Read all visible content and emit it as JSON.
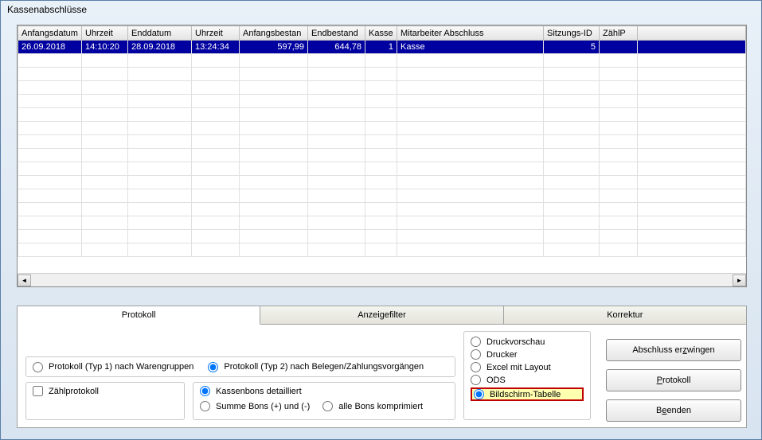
{
  "title": "Kassenabschlüsse",
  "columns": [
    "Anfangsdatum",
    "Uhrzeit",
    "Enddatum",
    "Uhrzeit",
    "Anfangsbestan",
    "Endbestand",
    "Kasse",
    "Mitarbeiter Abschluss",
    "Sitzungs-ID",
    "ZählP"
  ],
  "row": {
    "anfangsdatum": "26.09.2018",
    "uhrzeit1": "14:10:20",
    "enddatum": "28.09.2018",
    "uhrzeit2": "13:24:34",
    "anfangsbestand": "597,99",
    "endbestand": "644,78",
    "kasse": "1",
    "mitarbeiter": "Kasse",
    "sitzung": "5",
    "zaehlp": ""
  },
  "tabs": {
    "protokoll": "Protokoll",
    "anzeigefilter": "Anzeigefilter",
    "korrektur": "Korrektur"
  },
  "opts": {
    "typ1": "Protokoll (Typ 1) nach Warengruppen",
    "typ2": "Protokoll (Typ 2) nach Belegen/Zahlungsvorgängen",
    "zaehl": "Zählprotokoll",
    "kb_det": "Kassenbons detailliert",
    "summe": "Summe Bons (+) und (-)",
    "alle": "alle Bons komprimiert",
    "druckv": "Druckvorschau",
    "drucker": "Drucker",
    "excel": "Excel mit Layout",
    "ods": "ODS",
    "bild": "Bildschirm-Tabelle"
  },
  "buttons": {
    "erzwingen_pre": "Abschluss er",
    "erzwingen_u": "z",
    "erzwingen_post": "wingen",
    "protokoll_u": "P",
    "protokoll_post": "rotokoll",
    "beenden_pre": "B",
    "beenden_u": "e",
    "beenden_post": "enden"
  }
}
